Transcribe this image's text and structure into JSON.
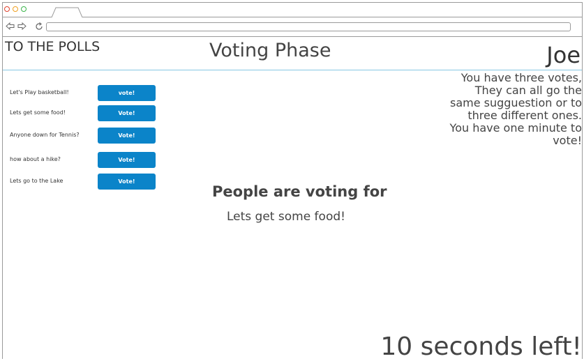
{
  "browser": {
    "window_controls": [
      {
        "name": "close",
        "color": "#e0442f"
      },
      {
        "name": "minimize",
        "color": "#f0a020"
      },
      {
        "name": "maximize",
        "color": "#3bb54a"
      }
    ],
    "url": ""
  },
  "header": {
    "app_title": "TO THE POLLS",
    "phase_title": "Voting Phase",
    "user_name": "Joe"
  },
  "instructions": {
    "lines": [
      "You have three votes,",
      "They can all go the",
      "same sugguestion or to",
      "three different ones.",
      "You have one minute to",
      "vote!"
    ]
  },
  "suggestions": [
    {
      "label": "Let's Play basketball!",
      "button": "vote!"
    },
    {
      "label": "Lets get some food!",
      "button": "Vote!"
    },
    {
      "label": "Anyone down for Tennis?",
      "button": "Vote!"
    },
    {
      "label": "how about a hike?",
      "button": "Vote!"
    },
    {
      "label": "Lets go to the Lake",
      "button": "Vote!"
    }
  ],
  "voting": {
    "heading": "People are voting for",
    "current_choice": "Lets get some food!"
  },
  "timer": {
    "text": "10 seconds left!"
  },
  "colors": {
    "accent": "#0b84c9",
    "header_rule": "#86c7e4"
  }
}
